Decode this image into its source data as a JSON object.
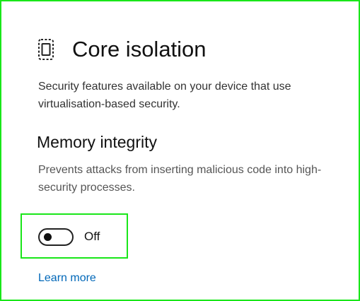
{
  "header": {
    "icon": "core-isolation-chip-icon",
    "title": "Core isolation"
  },
  "description": "Security features available on your device that use virtualisation-based security.",
  "memory_integrity": {
    "title": "Memory integrity",
    "description": "Prevents attacks from inserting malicious code into high-security processes.",
    "toggle_state": "Off",
    "toggle_on": false
  },
  "learn_more_label": "Learn more",
  "colors": {
    "highlight": "#19e619",
    "link": "#0067b8"
  }
}
